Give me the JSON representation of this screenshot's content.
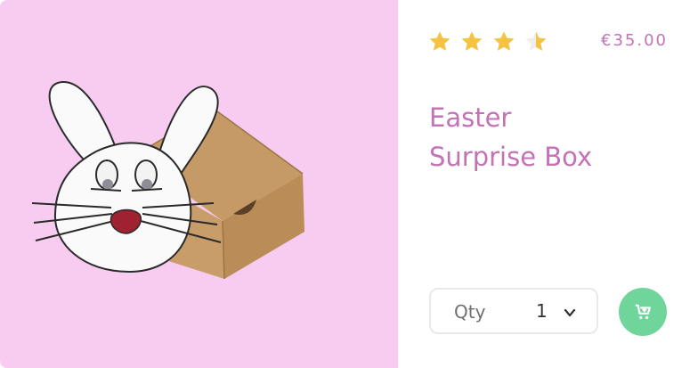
{
  "product": {
    "title_line1": "Easter",
    "title_line2": "Surprise Box",
    "price": "€35.00",
    "rating": 3.5,
    "rating_max": 4
  },
  "quantity": {
    "label": "Qty",
    "value": "1"
  },
  "colors": {
    "accent_pink": "#c471b6",
    "panel_pink": "#f8cbf0",
    "star_gold": "#f5c242",
    "cart_green": "#6fd59a"
  },
  "icons": {
    "cart": "add-to-cart-icon",
    "chevron": "chevron-down-icon",
    "star": "star-icon"
  }
}
